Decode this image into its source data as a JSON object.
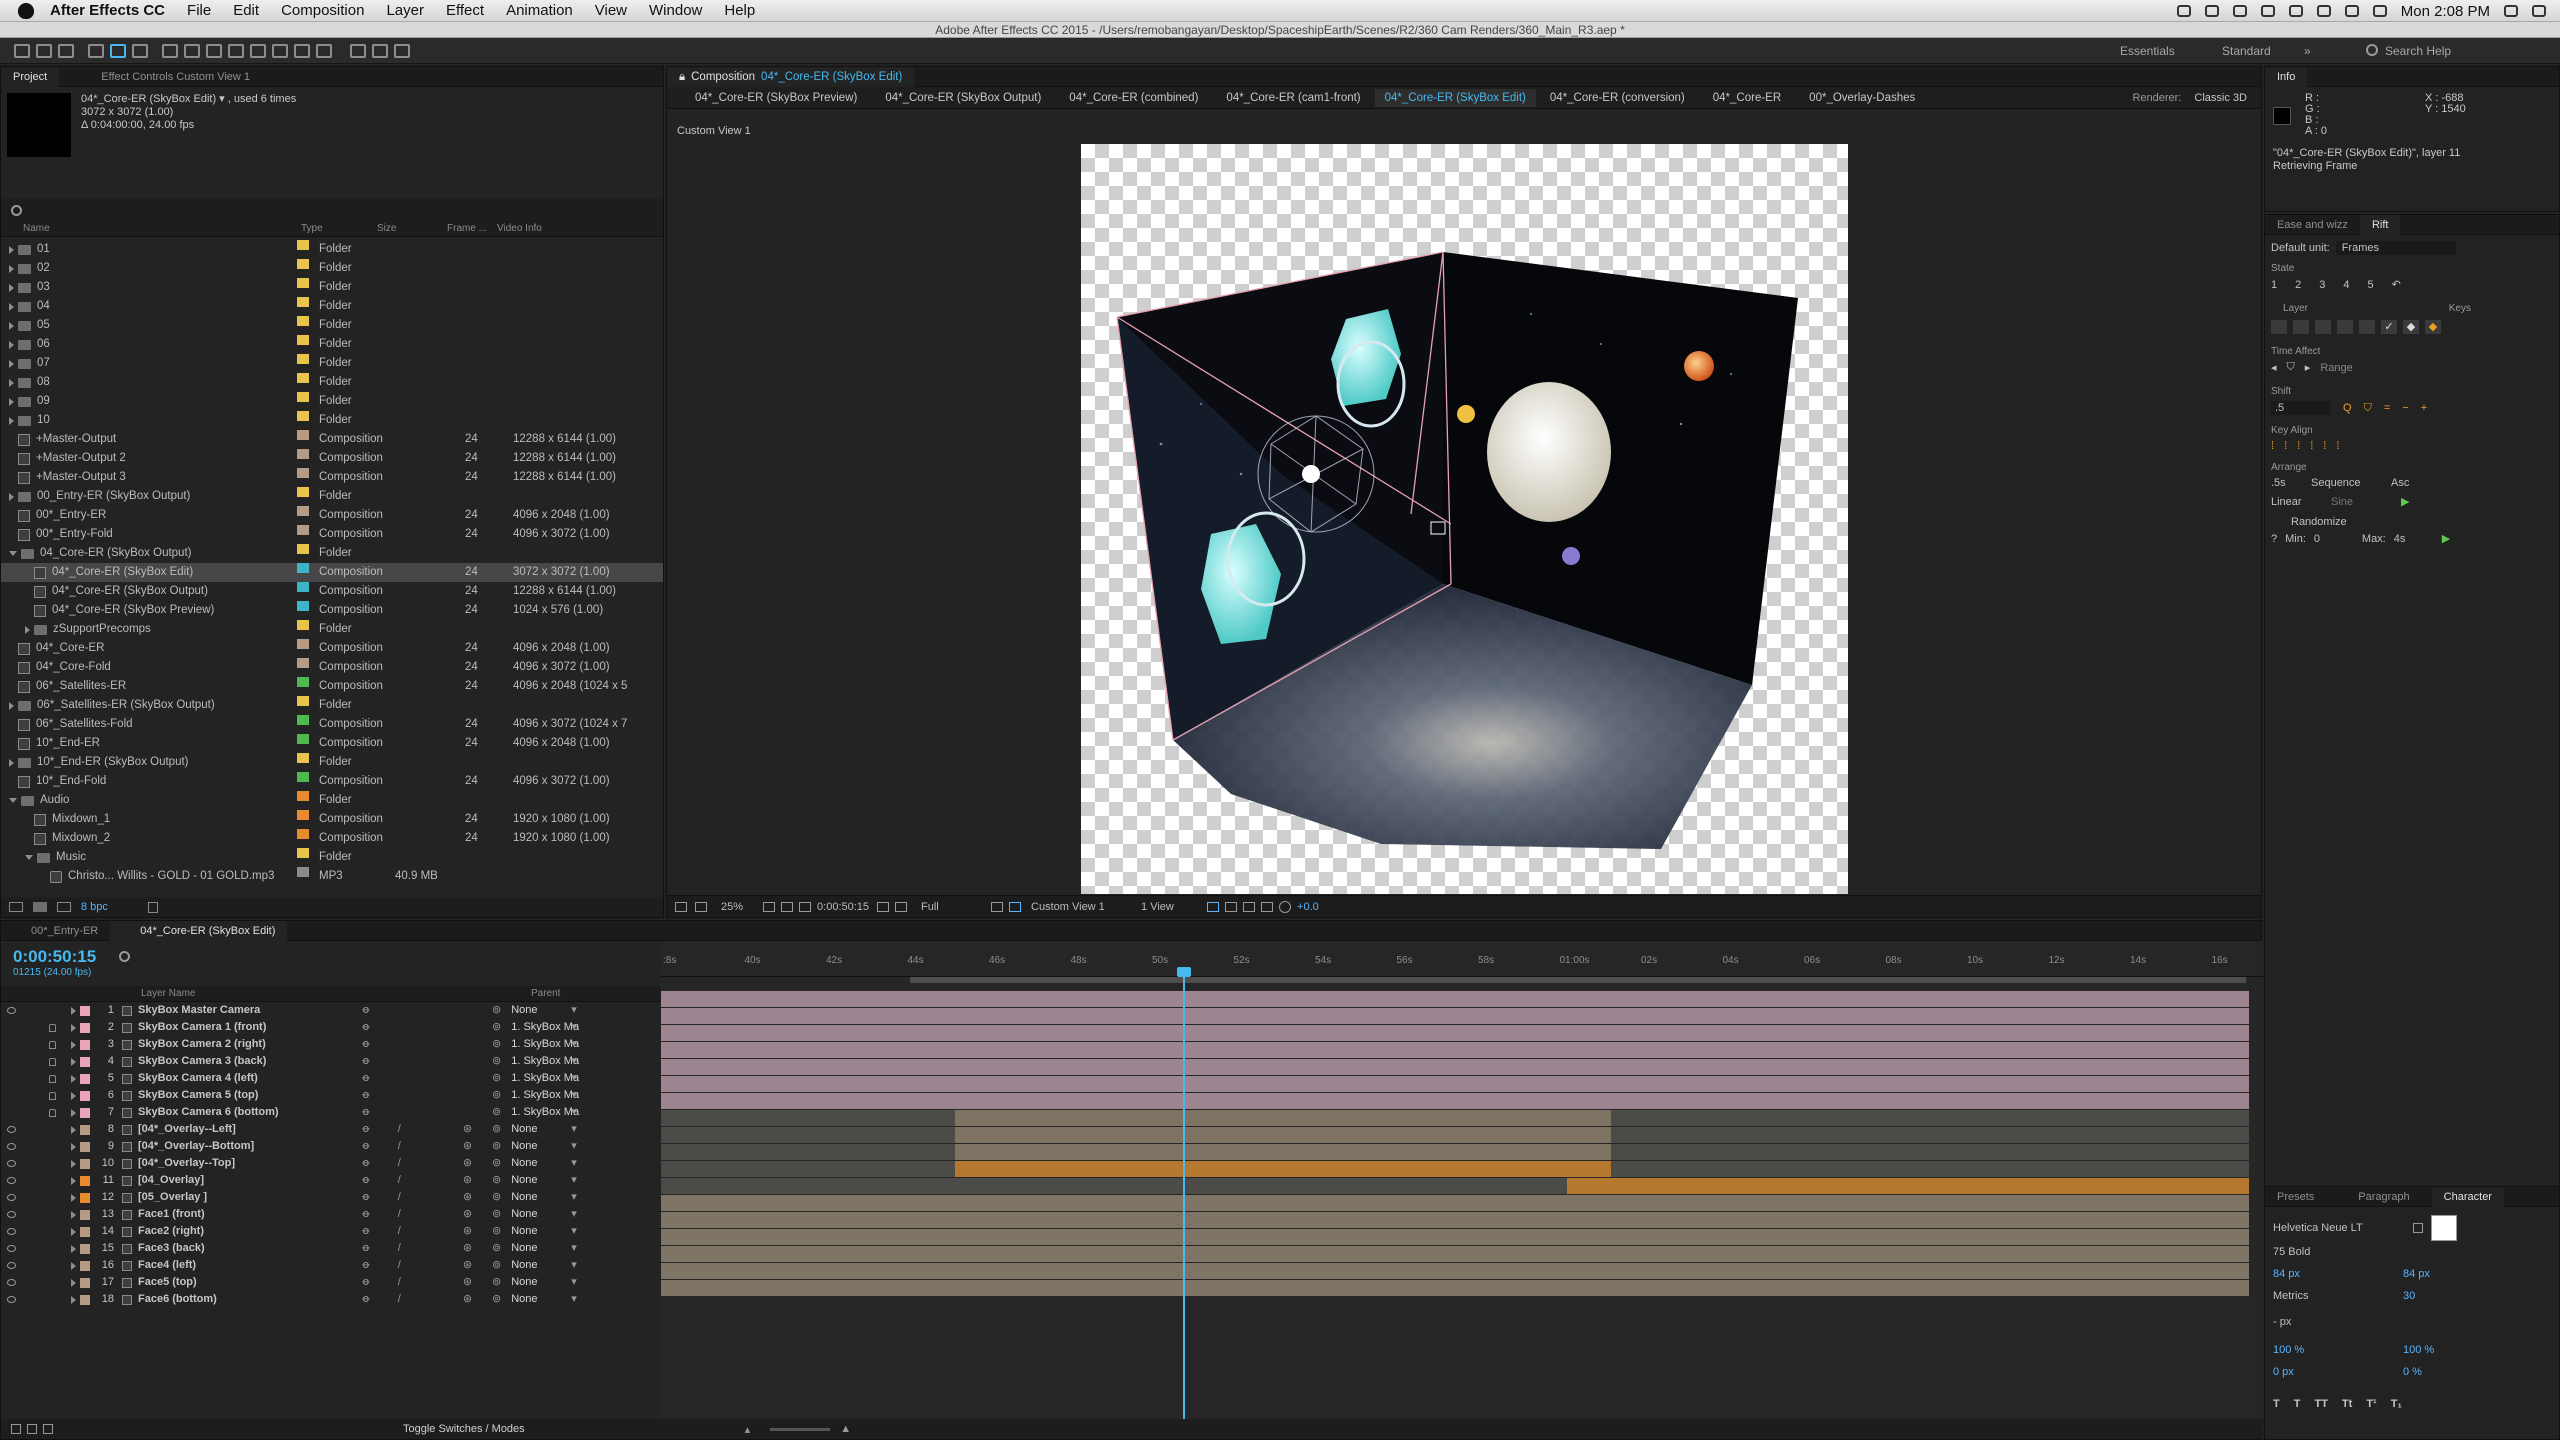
{
  "menubar": {
    "app": "After Effects CC",
    "items": [
      "File",
      "Edit",
      "Composition",
      "Layer",
      "Effect",
      "Animation",
      "View",
      "Window",
      "Help"
    ],
    "clock": "Mon 2:08 PM"
  },
  "title": "Adobe After Effects CC 2015 - /Users/remobangayan/Desktop/SpaceshipEarth/Scenes/R2/360 Cam Renders/360_Main_R3.aep *",
  "workspaces": [
    "Essentials",
    "Standard"
  ],
  "search_help": "Search Help",
  "project": {
    "tabs": [
      "Project",
      "Effect Controls Custom View 1"
    ],
    "selected_name": "04*_Core-ER (SkyBox Edit) ▾ , used 6 times",
    "selected_size": "3072 x 3072 (1.00)",
    "selected_dur": "Δ 0:04:00:00, 24.00 fps",
    "columns": [
      "Name",
      "Type",
      "Size",
      "Frame ...",
      "Video Info"
    ],
    "bpc": "8 bpc",
    "rows": [
      {
        "name": "01",
        "type": "Folder",
        "fr": "",
        "vi": "",
        "kind": "folder",
        "color": "#e8c44a",
        "depth": 0
      },
      {
        "name": "02",
        "type": "Folder",
        "fr": "",
        "vi": "",
        "kind": "folder",
        "color": "#e8c44a",
        "depth": 0
      },
      {
        "name": "03",
        "type": "Folder",
        "fr": "",
        "vi": "",
        "kind": "folder",
        "color": "#e8c44a",
        "depth": 0
      },
      {
        "name": "04",
        "type": "Folder",
        "fr": "",
        "vi": "",
        "kind": "folder",
        "color": "#e8c44a",
        "depth": 0
      },
      {
        "name": "05",
        "type": "Folder",
        "fr": "",
        "vi": "",
        "kind": "folder",
        "color": "#e8c44a",
        "depth": 0
      },
      {
        "name": "06",
        "type": "Folder",
        "fr": "",
        "vi": "",
        "kind": "folder",
        "color": "#e8c44a",
        "depth": 0
      },
      {
        "name": "07",
        "type": "Folder",
        "fr": "",
        "vi": "",
        "kind": "folder",
        "color": "#e8c44a",
        "depth": 0
      },
      {
        "name": "08",
        "type": "Folder",
        "fr": "",
        "vi": "",
        "kind": "folder",
        "color": "#e8c44a",
        "depth": 0
      },
      {
        "name": "09",
        "type": "Folder",
        "fr": "",
        "vi": "",
        "kind": "folder",
        "color": "#e8c44a",
        "depth": 0
      },
      {
        "name": "10",
        "type": "Folder",
        "fr": "",
        "vi": "",
        "kind": "folder",
        "color": "#e8c44a",
        "depth": 0
      },
      {
        "name": "+Master-Output",
        "type": "Composition",
        "fr": "24",
        "vi": "12288 x 6144 (1.00)",
        "kind": "comp",
        "color": "#b59b83",
        "depth": 0
      },
      {
        "name": "+Master-Output 2",
        "type": "Composition",
        "fr": "24",
        "vi": "12288 x 6144 (1.00)",
        "kind": "comp",
        "color": "#b59b83",
        "depth": 0
      },
      {
        "name": "+Master-Output 3",
        "type": "Composition",
        "fr": "24",
        "vi": "12288 x 6144 (1.00)",
        "kind": "comp",
        "color": "#b59b83",
        "depth": 0
      },
      {
        "name": "00_Entry-ER (SkyBox Output)",
        "type": "Folder",
        "fr": "",
        "vi": "",
        "kind": "folder",
        "color": "#e8c44a",
        "depth": 0
      },
      {
        "name": "00*_Entry-ER",
        "type": "Composition",
        "fr": "24",
        "vi": "4096 x 2048 (1.00)",
        "kind": "comp",
        "color": "#b59b83",
        "depth": 0
      },
      {
        "name": "00*_Entry-Fold",
        "type": "Composition",
        "fr": "24",
        "vi": "4096 x 3072 (1.00)",
        "kind": "comp",
        "color": "#b59b83",
        "depth": 0
      },
      {
        "name": "04_Core-ER (SkyBox Output)",
        "type": "Folder",
        "fr": "",
        "vi": "",
        "kind": "folder-open",
        "color": "#e8c44a",
        "depth": 0
      },
      {
        "name": "04*_Core-ER (SkyBox Edit)",
        "type": "Composition",
        "fr": "24",
        "vi": "3072 x 3072 (1.00)",
        "kind": "comp",
        "color": "#3fb3c8",
        "depth": 1,
        "selected": true
      },
      {
        "name": "04*_Core-ER (SkyBox Output)",
        "type": "Composition",
        "fr": "24",
        "vi": "12288 x 6144 (1.00)",
        "kind": "comp",
        "color": "#3fb3c8",
        "depth": 1
      },
      {
        "name": "04*_Core-ER (SkyBox Preview)",
        "type": "Composition",
        "fr": "24",
        "vi": "1024 x 576 (1.00)",
        "kind": "comp",
        "color": "#3fb3c8",
        "depth": 1
      },
      {
        "name": "zSupportPrecomps",
        "type": "Folder",
        "fr": "",
        "vi": "",
        "kind": "folder",
        "color": "#e8c44a",
        "depth": 1
      },
      {
        "name": "04*_Core-ER",
        "type": "Composition",
        "fr": "24",
        "vi": "4096 x 2048 (1.00)",
        "kind": "comp",
        "color": "#b59b83",
        "depth": 0
      },
      {
        "name": "04*_Core-Fold",
        "type": "Composition",
        "fr": "24",
        "vi": "4096 x 3072 (1.00)",
        "kind": "comp",
        "color": "#b59b83",
        "depth": 0
      },
      {
        "name": "06*_Satellites-ER",
        "type": "Composition",
        "fr": "24",
        "vi": "4096 x 2048 (1024 x 5",
        "kind": "comp",
        "color": "#4fb84f",
        "depth": 0
      },
      {
        "name": "06*_Satellites-ER (SkyBox Output)",
        "type": "Folder",
        "fr": "",
        "vi": "",
        "kind": "folder",
        "color": "#e8c44a",
        "depth": 0
      },
      {
        "name": "06*_Satellites-Fold",
        "type": "Composition",
        "fr": "24",
        "vi": "4096 x 3072  (1024 x 7",
        "kind": "comp",
        "color": "#4fb84f",
        "depth": 0
      },
      {
        "name": "10*_End-ER",
        "type": "Composition",
        "fr": "24",
        "vi": "4096 x 2048 (1.00)",
        "kind": "comp",
        "color": "#4fb84f",
        "depth": 0
      },
      {
        "name": "10*_End-ER (SkyBox Output)",
        "type": "Folder",
        "fr": "",
        "vi": "",
        "kind": "folder",
        "color": "#e8c44a",
        "depth": 0
      },
      {
        "name": "10*_End-Fold",
        "type": "Composition",
        "fr": "24",
        "vi": "4096 x 3072 (1.00)",
        "kind": "comp",
        "color": "#4fb84f",
        "depth": 0
      },
      {
        "name": "Audio",
        "type": "Folder",
        "fr": "",
        "vi": "",
        "kind": "folder-open",
        "color": "#e88a2e",
        "depth": 0
      },
      {
        "name": "Mixdown_1",
        "type": "Composition",
        "fr": "24",
        "vi": "1920 x 1080 (1.00)",
        "kind": "comp",
        "color": "#e88a2e",
        "depth": 1
      },
      {
        "name": "Mixdown_2",
        "type": "Composition",
        "fr": "24",
        "vi": "1920 x 1080 (1.00)",
        "kind": "comp",
        "color": "#e88a2e",
        "depth": 1
      },
      {
        "name": "Music",
        "type": "Folder",
        "fr": "",
        "vi": "",
        "kind": "folder-open",
        "color": "#e8c44a",
        "depth": 1
      },
      {
        "name": "Christo... Willits - GOLD - 01 GOLD.mp3",
        "type": "MP3",
        "fr": "",
        "vi": "",
        "kind": "file",
        "color": "#8a8a8a",
        "depth": 2,
        "size": "40.9 MB"
      }
    ]
  },
  "composition": {
    "label": "Composition",
    "name": "04*_Core-ER (SkyBox Edit)",
    "tabs": [
      "04*_Core-ER (SkyBox Preview)",
      "04*_Core-ER (SkyBox Output)",
      "04*_Core-ER (combined)",
      "04*_Core-ER (cam1-front)",
      "04*_Core-ER (SkyBox Edit)",
      "04*_Core-ER (conversion)",
      "04*_Core-ER",
      "00*_Overlay-Dashes"
    ],
    "active_tab": 4,
    "renderer_label": "Renderer:",
    "renderer": "Classic 3D",
    "view_label": "Custom View 1",
    "zoom": "25%",
    "timecode": "0:00:50:15",
    "resolution": "Full",
    "view": "Custom View 1",
    "views": "1 View",
    "exposure": "+0.0"
  },
  "info": {
    "title": "Info",
    "r": "R :",
    "g": "G :",
    "b": "B :",
    "a": "A : 0",
    "x": "X : -688",
    "y": "Y : 1540",
    "layer": "\"04*_Core-ER (SkyBox Edit)\", layer 11",
    "status": "Retrieving Frame"
  },
  "rift": {
    "tabs": [
      "Ease and wizz",
      "Rift"
    ],
    "default_unit_label": "Default unit:",
    "default_unit": "Frames",
    "state": "State",
    "states": [
      "1",
      "2",
      "3",
      "4",
      "5"
    ],
    "layer": "Layer",
    "keys": "Keys",
    "time_affect": "Time Affect",
    "range": "Range",
    "shift": "Shift",
    "shift_val": ".5",
    "key_align": "Key Align",
    "arrange": "Arrange",
    "arr_val": ".5s",
    "sequence": "Sequence",
    "asc": "Asc",
    "linear": "Linear",
    "sine": "Sine",
    "randomize": "Randomize",
    "min_label": "Min:",
    "min_val": "0",
    "max_label": "Max:",
    "max_val": "4s"
  },
  "character": {
    "tabs": [
      "Presets",
      "Paragraph",
      "Character"
    ],
    "font": "Helvetica Neue LT",
    "style": "75 Bold",
    "size": "84 px",
    "leading": "84 px",
    "metrics": "Metrics",
    "tracking": "30",
    "stroke": "- px",
    "vscale": "100 %",
    "hscale": "100 %",
    "baseline": "0 px",
    "tsume": "0 %"
  },
  "timeline": {
    "tabs": [
      "00*_Entry-ER",
      "04*_Core-ER (SkyBox Edit)"
    ],
    "timecode": "0:00:50:15",
    "frames": "01215 (24.00 fps)",
    "col_name": "Layer Name",
    "col_parent": "Parent",
    "ruler": [
      ":8s",
      "40s",
      "42s",
      "44s",
      "46s",
      "48s",
      "50s",
      "52s",
      "54s",
      "56s",
      "58s",
      "01:00s",
      "02s",
      "04s",
      "06s",
      "08s",
      "10s",
      "12s",
      "14s",
      "16s"
    ],
    "toggle": "Toggle Switches / Modes",
    "layers": [
      {
        "num": "1",
        "name": "SkyBox Master Camera",
        "parent": "None",
        "color": "#e8a6b8",
        "type": "camera",
        "bar": "cam"
      },
      {
        "num": "2",
        "name": "SkyBox Camera 1 (front)",
        "parent": "1. SkyBox Ma",
        "color": "#e8a6b8",
        "type": "camera",
        "bar": "cam"
      },
      {
        "num": "3",
        "name": "SkyBox Camera 2 (right)",
        "parent": "1. SkyBox Ma",
        "color": "#e8a6b8",
        "type": "camera",
        "bar": "cam"
      },
      {
        "num": "4",
        "name": "SkyBox Camera 3 (back)",
        "parent": "1. SkyBox Ma",
        "color": "#e8a6b8",
        "type": "camera",
        "bar": "cam"
      },
      {
        "num": "5",
        "name": "SkyBox Camera 4 (left)",
        "parent": "1. SkyBox Ma",
        "color": "#e8a6b8",
        "type": "camera",
        "bar": "cam"
      },
      {
        "num": "6",
        "name": "SkyBox Camera 5 (top)",
        "parent": "1. SkyBox Ma",
        "color": "#e8a6b8",
        "type": "camera",
        "bar": "cam"
      },
      {
        "num": "7",
        "name": "SkyBox Camera 6 (bottom)",
        "parent": "1. SkyBox Ma",
        "color": "#e8a6b8",
        "type": "camera",
        "bar": "cam"
      },
      {
        "num": "8",
        "name": "[04*_Overlay--Left]",
        "parent": "None",
        "color": "#b59b83",
        "type": "comp",
        "bar": "overlay"
      },
      {
        "num": "9",
        "name": "[04*_Overlay--Bottom]",
        "parent": "None",
        "color": "#b59b83",
        "type": "comp",
        "bar": "overlay"
      },
      {
        "num": "10",
        "name": "[04*_Overlay--Top]",
        "parent": "None",
        "color": "#b59b83",
        "type": "comp",
        "bar": "overlay"
      },
      {
        "num": "11",
        "name": "[04_Overlay]",
        "parent": "None",
        "color": "#e88a2e",
        "type": "comp",
        "bar": "orange1"
      },
      {
        "num": "12",
        "name": "[05_Overlay ]",
        "parent": "None",
        "color": "#e88a2e",
        "type": "comp",
        "bar": "orange2"
      },
      {
        "num": "13",
        "name": "Face1 (front)",
        "parent": "None",
        "color": "#b59b83",
        "type": "comp",
        "bar": "face"
      },
      {
        "num": "14",
        "name": "Face2 (right)",
        "parent": "None",
        "color": "#b59b83",
        "type": "comp",
        "bar": "face"
      },
      {
        "num": "15",
        "name": "Face3 (back)",
        "parent": "None",
        "color": "#b59b83",
        "type": "comp",
        "bar": "face"
      },
      {
        "num": "16",
        "name": "Face4 (left)",
        "parent": "None",
        "color": "#b59b83",
        "type": "comp",
        "bar": "face"
      },
      {
        "num": "17",
        "name": "Face5 (top)",
        "parent": "None",
        "color": "#b59b83",
        "type": "comp",
        "bar": "face"
      },
      {
        "num": "18",
        "name": "Face6 (bottom)",
        "parent": "None",
        "color": "#b59b83",
        "type": "comp",
        "bar": "face"
      }
    ]
  },
  "colors": {
    "accent": "#46b9f0",
    "selection": "#47474a"
  }
}
